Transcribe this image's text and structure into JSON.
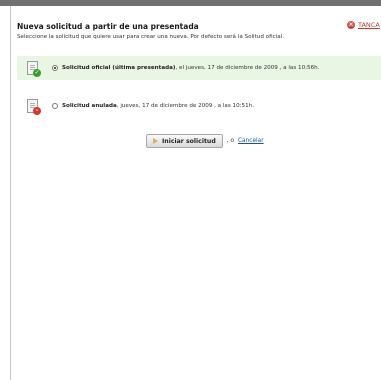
{
  "dialog": {
    "title": "Nueva solicitud a partir de una presentada",
    "close_label": "TANCA",
    "close_icon": "close-icon",
    "subtitle": "Seleccione la solicitud que quiere usar para crear una nueva. Por defecto será la Solitud oficial."
  },
  "options": [
    {
      "strong": "Solicitud oficial (última presentada)",
      "rest": ", el jueves, 17 de diciembre de 2009 , a las 10:56h.",
      "icon": "document-ok-icon",
      "selected": true
    },
    {
      "strong": "Solicitud anulada",
      "rest": ", jueves, 17 de diciembre de 2009 , a las 10:51h.",
      "icon": "document-cancelled-icon",
      "selected": false
    }
  ],
  "actions": {
    "start_label": "Iniciar solicitud",
    "separator": ", o",
    "cancel_label": "Cancelar"
  },
  "colors": {
    "selected_row": "#eaf6e4",
    "link": "#1a4fa0",
    "close": "#c0392b"
  }
}
